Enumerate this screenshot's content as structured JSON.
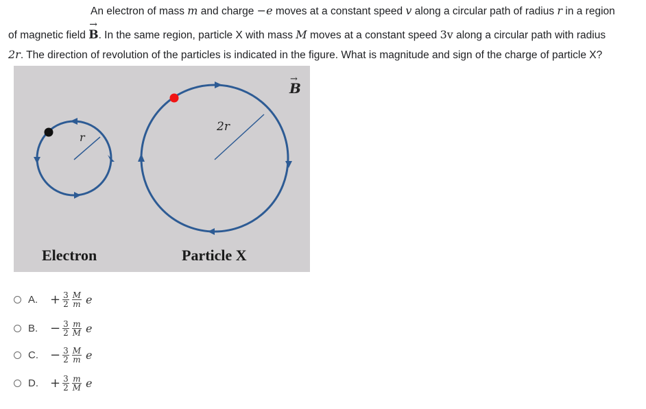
{
  "question": {
    "line1": {
      "t1": "An electron of mass ",
      "m1": "m",
      "t2": " and charge ",
      "m2": "−e",
      "t3": " moves at a constant speed ",
      "m3": "v",
      "t4": " along a circular path of radius ",
      "m4": "r",
      "t5": " in a region"
    },
    "line2": {
      "t1": "of magnetic field ",
      "m1": "B",
      "vec": "→",
      "t2": ". In the same region, particle X with mass ",
      "m2": "M",
      "t3": " moves at a constant speed ",
      "m3": "3v",
      "t4": " along a circular path with radius"
    },
    "line3": {
      "m1": "2r",
      "t1": ". The direction of revolution of the particles is indicated in the figure. What is magnitude and sign of the charge of particle X?"
    }
  },
  "figure": {
    "field_label": "B",
    "field_vec": "→",
    "electron": {
      "label": "Electron",
      "radius_label": "r",
      "direction": "counterclockwise",
      "dot_color": "#111111"
    },
    "particle_x": {
      "label": "Particle X",
      "radius_label": "2r",
      "direction": "clockwise",
      "dot_color": "#f01414"
    },
    "colors": {
      "background": "#d1cfd1",
      "path": "#2d5b94"
    }
  },
  "options": [
    {
      "letter": "A.",
      "sign": "+",
      "num1": "3",
      "den1": "2",
      "num2": "M",
      "den2": "m",
      "e": "e"
    },
    {
      "letter": "B.",
      "sign": "−",
      "num1": "3",
      "den1": "2",
      "num2": "m",
      "den2": "M",
      "e": "e"
    },
    {
      "letter": "C.",
      "sign": "−",
      "num1": "3",
      "den1": "2",
      "num2": "M",
      "den2": "m",
      "e": "e"
    },
    {
      "letter": "D.",
      "sign": "+",
      "num1": "3",
      "den1": "2",
      "num2": "m",
      "den2": "M",
      "e": "e"
    }
  ]
}
